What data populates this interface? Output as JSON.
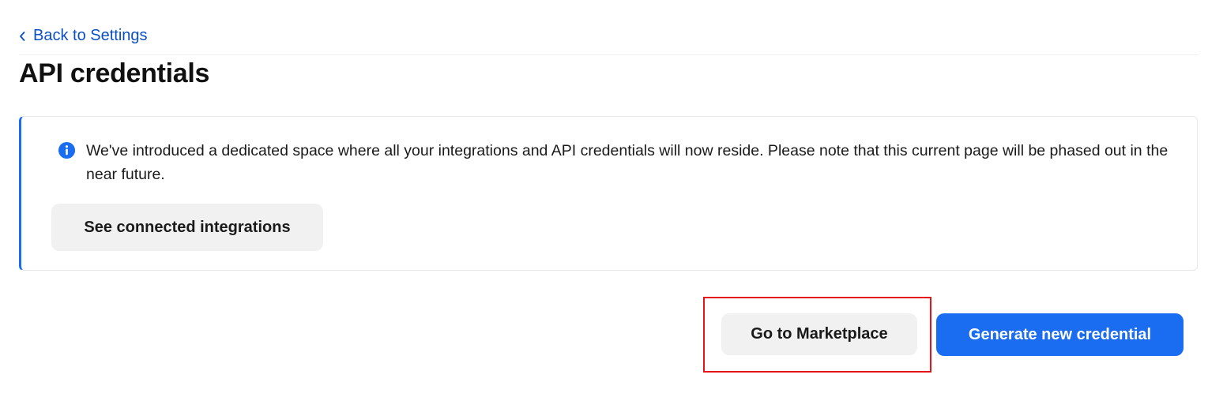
{
  "nav": {
    "back_label": "Back to Settings"
  },
  "header": {
    "title": "API credentials"
  },
  "notice": {
    "icon": "info-icon",
    "text": "We've introduced a dedicated space where all your integrations and API credentials will now reside. Please note that this current page will be phased out in the near future.",
    "button_label": "See connected integrations"
  },
  "actions": {
    "marketplace_label": "Go to Marketplace",
    "generate_label": "Generate new credential"
  },
  "colors": {
    "accent": "#1a6cf0",
    "link": "#0b4fc4",
    "highlight": "#e8121b",
    "secondary_button": "#f1f1f1"
  }
}
